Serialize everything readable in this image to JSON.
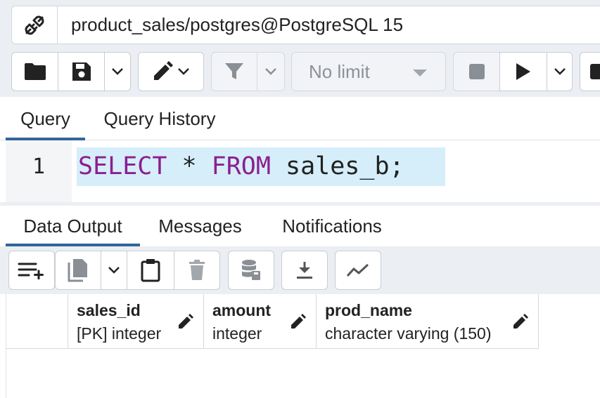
{
  "connection": {
    "label": "product_sales/postgres@PostgreSQL 15"
  },
  "toolbar": {
    "limit_value": "No limit"
  },
  "query_tabs": [
    {
      "label": "Query",
      "active": true
    },
    {
      "label": "Query History",
      "active": false
    }
  ],
  "editor": {
    "line_number": "1",
    "keyword_select": "SELECT",
    "star": " * ",
    "keyword_from": "FROM",
    "rest": " sales_b;"
  },
  "output_tabs": [
    {
      "label": "Data Output",
      "active": true
    },
    {
      "label": "Messages",
      "active": false
    },
    {
      "label": "Notifications",
      "active": false
    }
  ],
  "grid": {
    "columns": [
      {
        "name": "sales_id",
        "type": "[PK] integer"
      },
      {
        "name": "amount",
        "type": "integer"
      },
      {
        "name": "prod_name",
        "type": "character varying (150)"
      }
    ]
  },
  "colors": {
    "accent": "#336699",
    "keyword": "#8b1f8f",
    "selection": "#d6eefa",
    "panel": "#ebeef3"
  }
}
